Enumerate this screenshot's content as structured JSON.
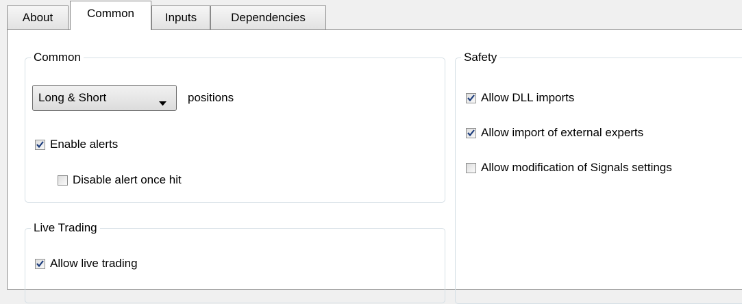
{
  "tabs": [
    {
      "label": "About",
      "active": false
    },
    {
      "label": "Common",
      "active": true
    },
    {
      "label": "Inputs",
      "active": false
    },
    {
      "label": "Dependencies",
      "active": false
    }
  ],
  "common_group": {
    "title": "Common",
    "position_select": {
      "value": "Long & Short"
    },
    "positions_label": "positions",
    "enable_alerts": {
      "label": "Enable alerts",
      "checked": true
    },
    "disable_alert_once_hit": {
      "label": "Disable alert once hit",
      "checked": false
    }
  },
  "live_trading_group": {
    "title": "Live Trading",
    "allow_live_trading": {
      "label": "Allow live trading",
      "checked": true
    }
  },
  "safety_group": {
    "title": "Safety",
    "allow_dll_imports": {
      "label": "Allow DLL imports",
      "checked": true
    },
    "allow_import_external_experts": {
      "label": "Allow import of external experts",
      "checked": true
    },
    "allow_modification_signals": {
      "label": "Allow modification of Signals settings",
      "checked": false
    }
  },
  "colors": {
    "check": "#1c3c7c",
    "border": "#8a8a8a",
    "group_border": "#d5dfe5"
  }
}
